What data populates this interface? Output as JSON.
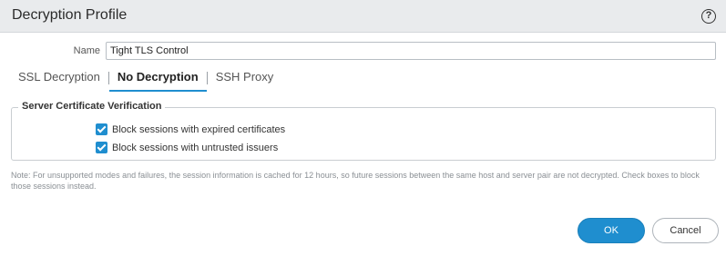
{
  "dialog": {
    "title": "Decryption Profile",
    "help_icon_glyph": "?",
    "help_icon_name": "help-circle-icon"
  },
  "name_field": {
    "label": "Name",
    "value": "Tight TLS Control"
  },
  "tabs": [
    {
      "label": "SSL Decryption",
      "active": false
    },
    {
      "label": "No Decryption",
      "active": true
    },
    {
      "label": "SSH Proxy",
      "active": false
    }
  ],
  "server_certificate_verification": {
    "legend": "Server Certificate Verification",
    "options": [
      {
        "label": "Block sessions with expired certificates",
        "checked": true
      },
      {
        "label": "Block sessions with untrusted issuers",
        "checked": true
      }
    ]
  },
  "note": "Note: For unsupported modes and failures, the session information is cached for 12 hours, so future sessions between the same host and server pair are not decrypted. Check boxes to block those sessions instead.",
  "buttons": {
    "ok_label": "OK",
    "cancel_label": "Cancel"
  },
  "colors": {
    "accent": "#1f8ecf",
    "header_bg": "#e9ebed",
    "note_text": "#8a8f94"
  }
}
